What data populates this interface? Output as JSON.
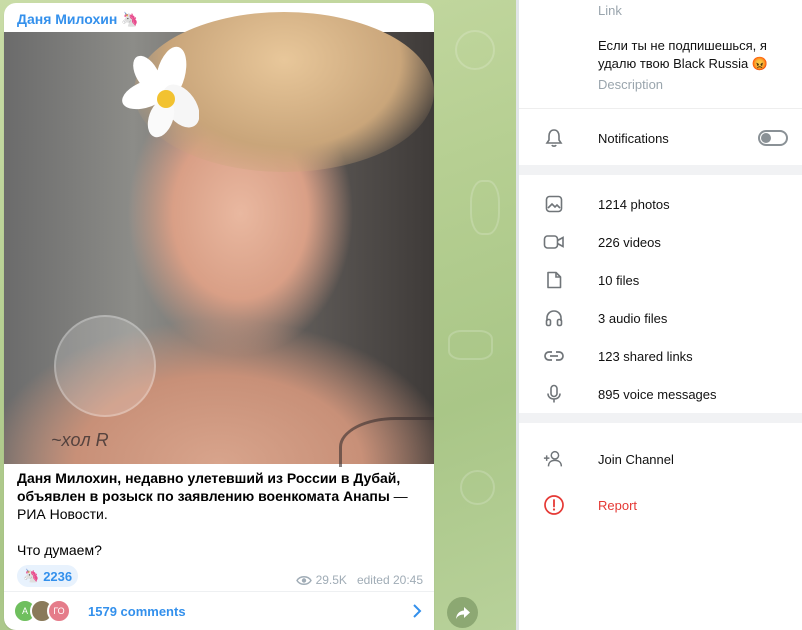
{
  "message": {
    "channel_name": "Даня Милохин",
    "channel_emoji": "🦄",
    "text_bold": "Даня Милохин, недавно улетевший из России в Дубай, объявлен в розыск по заявлению военкомата Анапы",
    "text_rest": " — РИА Новости.",
    "question": "Что думаем?",
    "reaction_emoji": "🦄",
    "reaction_count": "2236",
    "views": "29.5K",
    "edited": "edited 20:45",
    "comments": "1579 comments",
    "comment_avatars": [
      {
        "initial": "A",
        "color": "#6fbf5e"
      },
      {
        "initial": "",
        "color": "#8a7a5a"
      },
      {
        "initial": "ГО",
        "color": "#e57c8a"
      }
    ],
    "photo_tattoo_text": "~xoл R"
  },
  "panel": {
    "link_label": "Link",
    "description": "Если ты не подпишешься, я удалю твою Black Russia 😡",
    "description_label": "Description",
    "notifications_label": "Notifications",
    "notifications_on": false,
    "media": [
      {
        "icon": "photo-icon",
        "label": "1214 photos"
      },
      {
        "icon": "video-icon",
        "label": "226 videos"
      },
      {
        "icon": "file-icon",
        "label": "10 files"
      },
      {
        "icon": "headphones-icon",
        "label": "3 audio files"
      },
      {
        "icon": "link-icon",
        "label": "123 shared links"
      },
      {
        "icon": "microphone-icon",
        "label": "895 voice messages"
      }
    ],
    "join_label": "Join Channel",
    "report_label": "Report",
    "report_color": "#e53935",
    "accent_color": "#3390ec"
  }
}
